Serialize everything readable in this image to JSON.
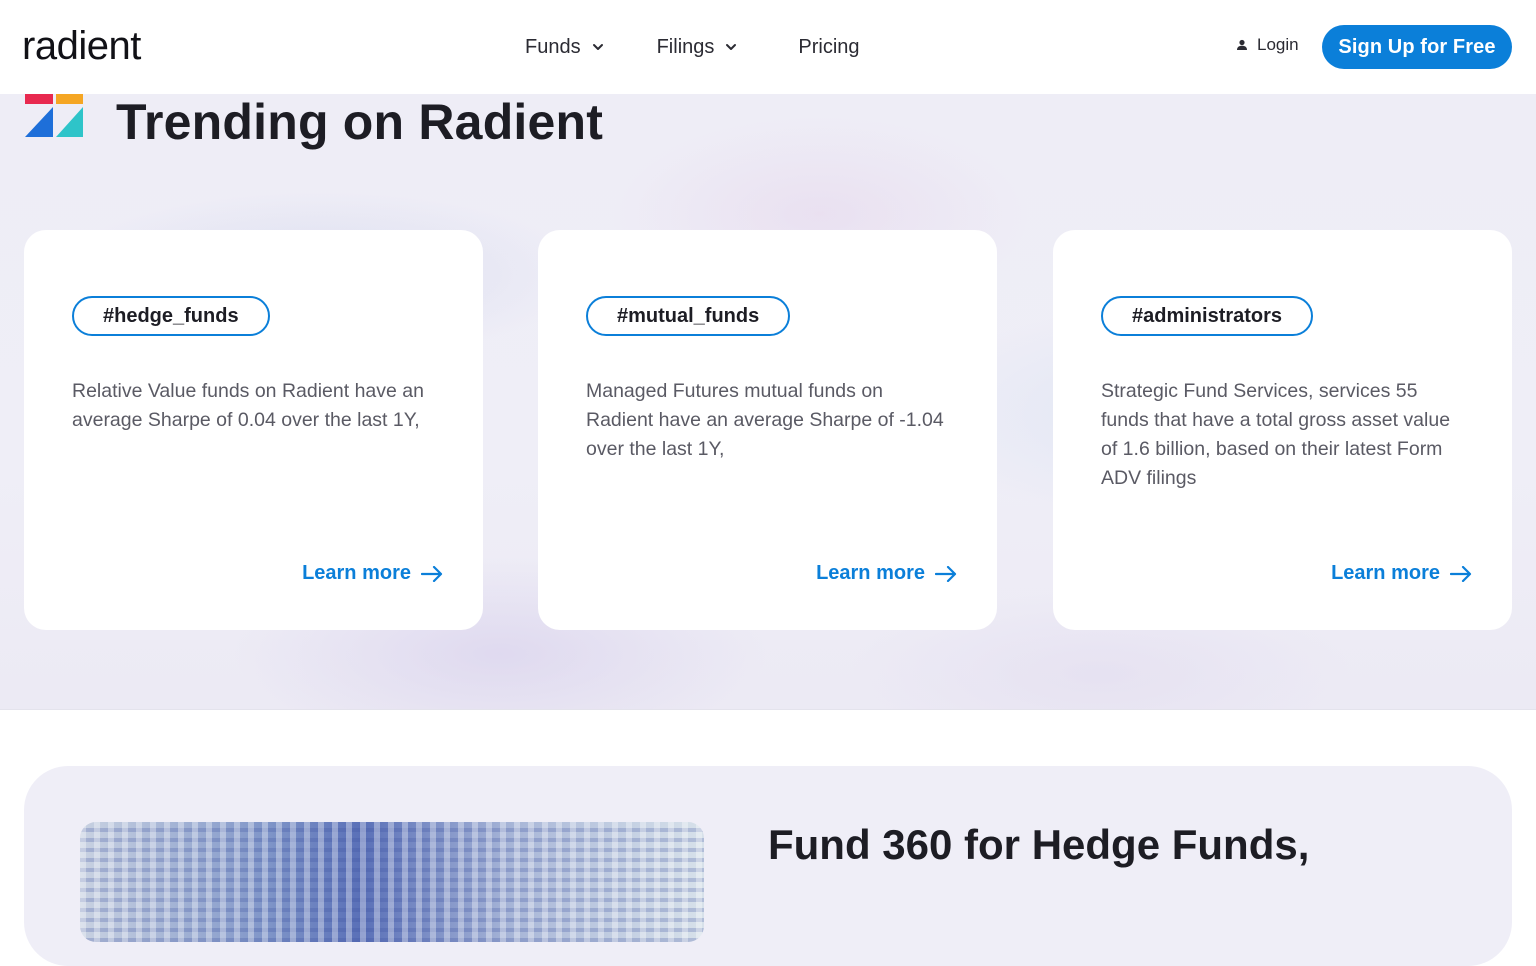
{
  "header": {
    "logo": "radient",
    "nav": {
      "funds_label": "Funds",
      "filings_label": "Filings",
      "pricing_label": "Pricing"
    },
    "login_label": "Login",
    "signup_label": "Sign Up for Free",
    "icons": {
      "chevron": "chevron-down-icon",
      "user": "user-icon"
    }
  },
  "trending": {
    "title": "Trending on Radient",
    "cards": [
      {
        "tag": "#hedge_funds",
        "text": "Relative Value funds on Radient have an average Sharpe of 0.04 over the last 1Y,",
        "link_label": "Learn more"
      },
      {
        "tag": "#mutual_funds",
        "text": "Managed Futures mutual funds on Radient have an average Sharpe of -1.04 over the last 1Y,",
        "link_label": "Learn more"
      },
      {
        "tag": "#administrators",
        "text": "Strategic Fund Services, services 55 funds that have a total gross asset value of 1.6 billion, based on their latest Form ADV filings",
        "link_label": "Learn more"
      }
    ]
  },
  "fund360": {
    "title_bold": "Fund 360",
    "title_rest": " for Hedge Funds,"
  },
  "colors": {
    "accent": "#0b7fd9",
    "text_dark": "#1d1d24",
    "text_body": "#5a5a64",
    "section_bg": "#efeef7"
  }
}
